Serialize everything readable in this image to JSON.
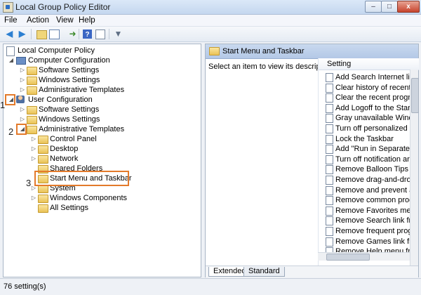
{
  "window": {
    "title": "Local Group Policy Editor",
    "min_glyph": "–",
    "max_glyph": "□",
    "close_glyph": "x"
  },
  "menu": [
    "File",
    "Action",
    "View",
    "Help"
  ],
  "toolbar": {
    "icons": [
      "back-arrow-icon",
      "forward-arrow-icon",
      "up-folder-icon",
      "show-hide-tree-icon",
      "export-list-icon",
      "help-icon",
      "properties-icon",
      "filter-icon"
    ]
  },
  "tree": [
    {
      "label": "Local Computer Policy",
      "icon": "document-icon",
      "expanded": true
    },
    {
      "label": "Computer Configuration",
      "icon": "computer-icon",
      "expanded": true
    },
    {
      "label": "Software Settings",
      "icon": "folder-icon",
      "expanded": false
    },
    {
      "label": "Windows Settings",
      "icon": "folder-icon",
      "expanded": false
    },
    {
      "label": "Administrative Templates",
      "icon": "folder-icon",
      "expanded": false
    },
    {
      "label": "User Configuration",
      "icon": "user-icon",
      "expanded": true
    },
    {
      "label": "Software Settings",
      "icon": "folder-icon",
      "expanded": false
    },
    {
      "label": "Windows Settings",
      "icon": "folder-icon",
      "expanded": false
    },
    {
      "label": "Administrative Templates",
      "icon": "folder-icon",
      "expanded": true
    },
    {
      "label": "Control Panel",
      "icon": "folder-icon",
      "expanded": false
    },
    {
      "label": "Desktop",
      "icon": "folder-icon",
      "expanded": false
    },
    {
      "label": "Network",
      "icon": "folder-icon",
      "expanded": false
    },
    {
      "label": "Shared Folders",
      "icon": "folder-icon",
      "expanded": false
    },
    {
      "label": "Start Menu and Taskbar",
      "icon": "folder-icon",
      "expanded": false,
      "selected": true
    },
    {
      "label": "System",
      "icon": "folder-icon",
      "expanded": false
    },
    {
      "label": "Windows Components",
      "icon": "folder-icon",
      "expanded": false
    },
    {
      "label": "All Settings",
      "icon": "folder-icon",
      "expanded": false
    }
  ],
  "annotations": [
    "1",
    "2",
    "3"
  ],
  "annotation_color": "#e37a2b",
  "right_pane": {
    "header": "Start Menu and Taskbar",
    "message": "Select an item to view its description.",
    "column_header": "Setting",
    "settings": [
      "Add Search Internet link t",
      "Clear history of recently c",
      "Clear the recent program",
      "Add Logoff to the Start M",
      "Gray unavailable Window",
      "Turn off personalized me",
      "Lock the Taskbar",
      "Add \"Run in Separate Me",
      "Turn off notification area",
      "Remove Balloon Tips on S",
      "Remove drag-and-drop a",
      "Remove and prevent acce",
      "Remove common progra",
      "Remove Favorites menu f",
      "Remove Search link from",
      "Remove frequent prograr",
      "Remove Games link from",
      "Remove Help menu from"
    ],
    "tabs": [
      "Extended",
      "Standard"
    ]
  },
  "status": "76 setting(s)"
}
